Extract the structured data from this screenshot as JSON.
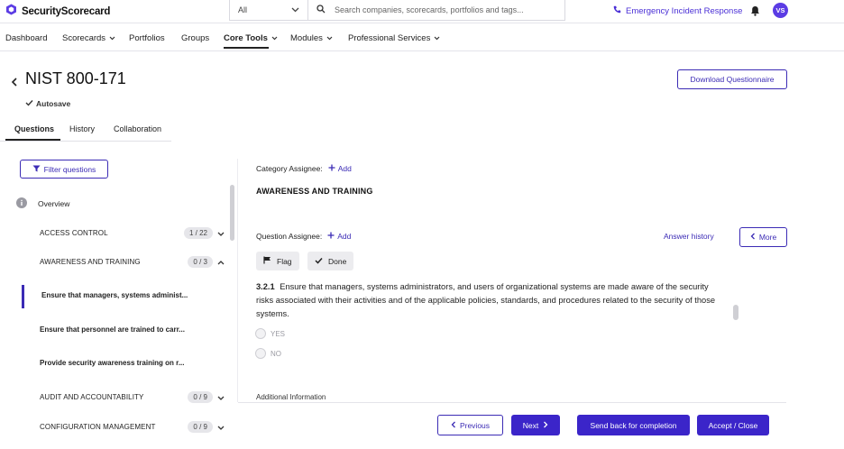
{
  "app": {
    "brand": "SecurityScorecard"
  },
  "topbar": {
    "scope_value": "All",
    "search_placeholder": "Search companies, scorecards, portfolios and tags...",
    "emergency_label": "Emergency Incident Response",
    "avatar_initials": "VS"
  },
  "nav": {
    "items": [
      {
        "label": "Dashboard"
      },
      {
        "label": "Scorecards"
      },
      {
        "label": "Portfolios"
      },
      {
        "label": "Groups"
      },
      {
        "label": "Core Tools"
      },
      {
        "label": "Modules"
      },
      {
        "label": "Professional Services"
      }
    ]
  },
  "page": {
    "title": "NIST 800-171",
    "autosave": "Autosave",
    "download_label": "Download Questionnaire"
  },
  "tabs": [
    {
      "label": "Questions"
    },
    {
      "label": "History"
    },
    {
      "label": "Collaboration"
    }
  ],
  "sidebar": {
    "filter_label": "Filter questions",
    "overview_label": "Overview",
    "categories": [
      {
        "label": "ACCESS CONTROL",
        "count": "1 / 22"
      },
      {
        "label": "AWARENESS AND TRAINING",
        "count": "0 / 3"
      },
      {
        "label": "AUDIT AND ACCOUNTABILITY",
        "count": "0 / 9"
      },
      {
        "label": "CONFIGURATION MANAGEMENT",
        "count": "0 / 9"
      }
    ],
    "questions": [
      {
        "label": "Ensure that managers, systems administ..."
      },
      {
        "label": "Ensure that personnel are trained to carr..."
      },
      {
        "label": "Provide security awareness training on r..."
      }
    ]
  },
  "main": {
    "category_assignee_label": "Category Assignee:",
    "question_assignee_label": "Question Assignee:",
    "add_label": "Add",
    "section_title": "AWARENESS AND TRAINING",
    "answer_history_label": "Answer history",
    "more_label": "More",
    "flag_label": "Flag",
    "done_label": "Done",
    "question_number": "3.2.1",
    "question_text": "Ensure that managers, systems administrators, and users of organizational systems are made aware of the security risks associated with their activities and of the applicable policies, standards, and procedures related to the security of those systems.",
    "options": [
      {
        "label": "YES"
      },
      {
        "label": "NO"
      }
    ],
    "additional_info_label": "Additional Information"
  },
  "footer": {
    "previous_label": "Previous",
    "next_label": "Next",
    "send_back_label": "Send back for completion",
    "accept_label": "Accept / Close"
  },
  "colors": {
    "accent": "#3b25c9",
    "accent_text": "#3b2bb5",
    "emergency": "#4a2fd6"
  }
}
